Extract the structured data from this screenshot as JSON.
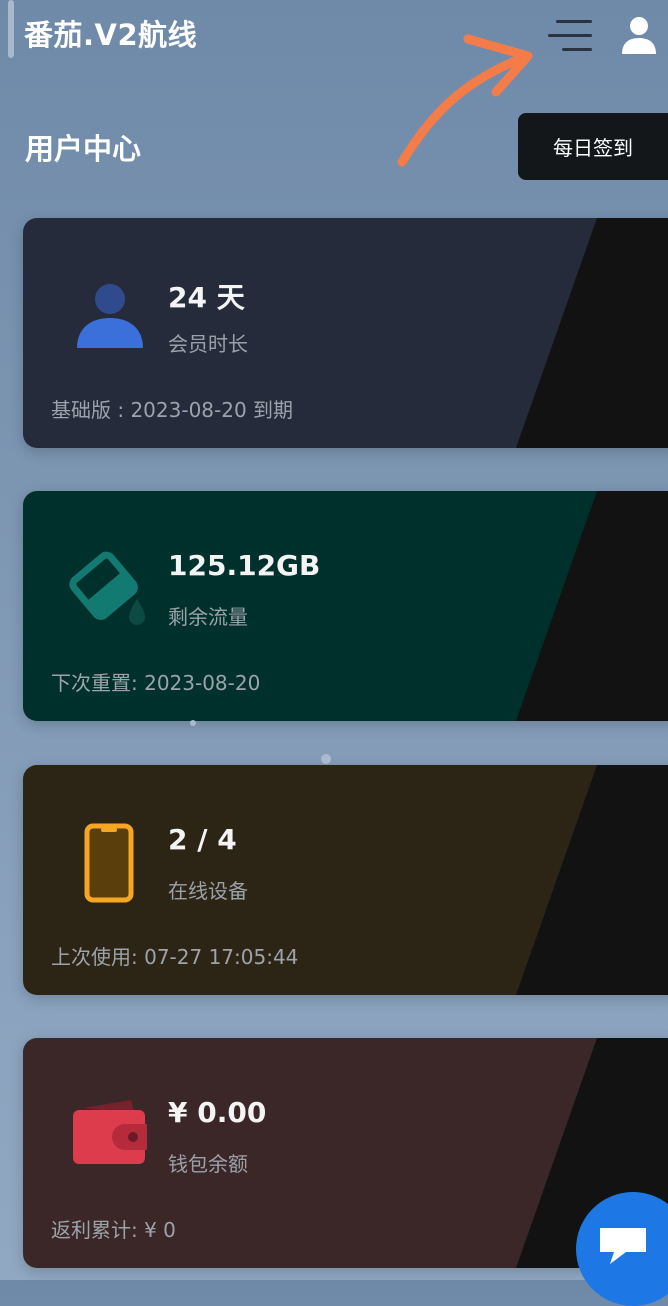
{
  "header": {
    "brand": "番茄.V2航线",
    "menu_icon": "hamburger-menu-icon",
    "user_icon": "user-icon"
  },
  "page": {
    "title": "用户中心",
    "signin_label": "每日签到"
  },
  "cards": [
    {
      "value": "24 天",
      "label": "会员时长",
      "footer": "基础版 : 2023-08-20 到期",
      "icon": "person-icon",
      "color": "#252b3b"
    },
    {
      "value": "125.12GB",
      "label": "剩余流量",
      "footer": "下次重置:  2023-08-20",
      "icon": "paint-bucket-icon",
      "color": "#00302c"
    },
    {
      "value": "2 / 4",
      "label": "在线设备",
      "footer": "上次使用: 07-27 17:05:44",
      "icon": "phone-icon",
      "color": "#2c2516"
    },
    {
      "value": "¥ 0.00",
      "label": "钱包余额",
      "footer": "返利累计: ¥ 0",
      "icon": "wallet-icon",
      "color": "#3b2628"
    }
  ],
  "chat_icon": "chat-icon",
  "colors": {
    "accent_arrow": "#f47c48",
    "chat_button": "#1d78e6"
  }
}
